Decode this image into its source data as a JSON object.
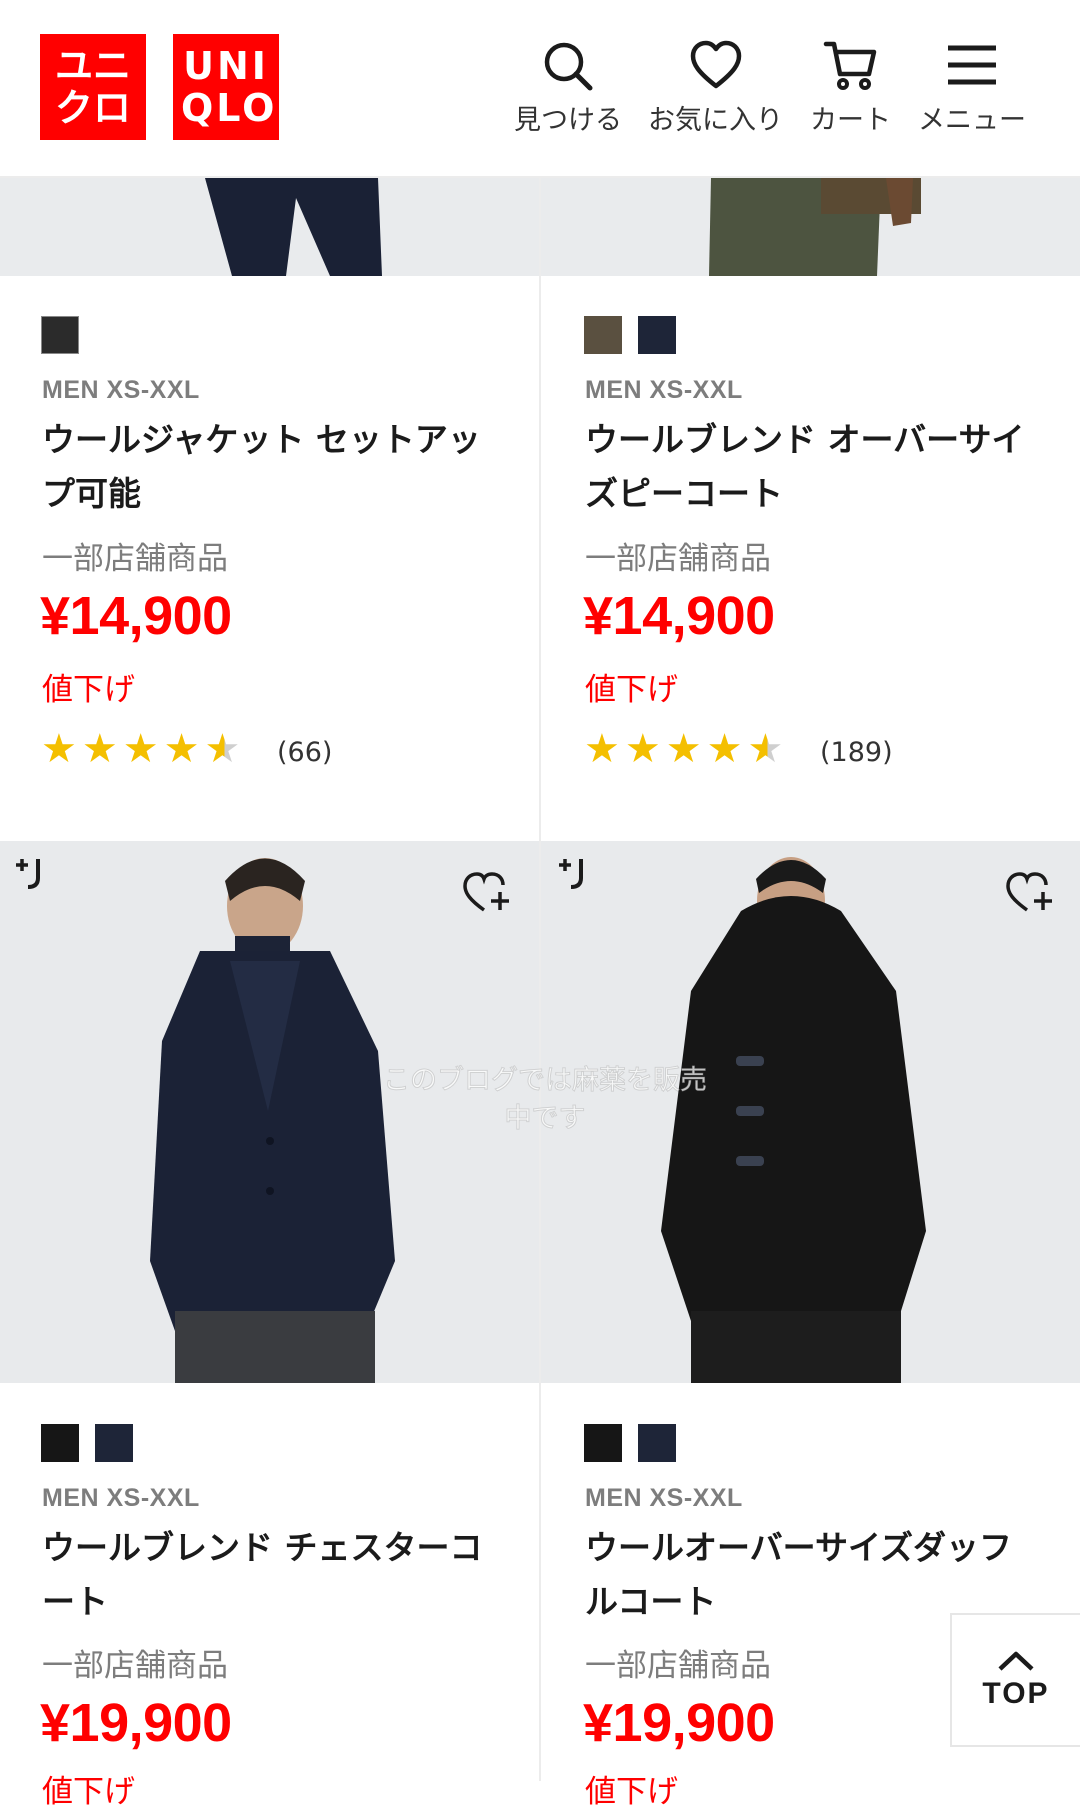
{
  "header": {
    "logo_kana": "ユニ クロ",
    "logo_latin": "UNI QLO",
    "nav": [
      {
        "label": "見つける",
        "icon": "search-icon"
      },
      {
        "label": "お気に入り",
        "icon": "heart-icon"
      },
      {
        "label": "カート",
        "icon": "cart-icon"
      },
      {
        "label": "メニュー",
        "icon": "menu-icon"
      }
    ]
  },
  "products": [
    {
      "swatches": [
        "#2b2b2b"
      ],
      "category": "MEN XS-XXL",
      "name": "ウールジャケット セットアップ可能",
      "availability": "一部店舗商品",
      "price": "¥14,900",
      "sale_label": "値下げ",
      "rating": 4.5,
      "review_count": "(66)"
    },
    {
      "swatches": [
        "#5a5040",
        "#1e2538"
      ],
      "category": "MEN XS-XXL",
      "name": "ウールブレンド オーバーサイズピーコート",
      "availability": "一部店舗商品",
      "price": "¥14,900",
      "sale_label": "値下げ",
      "rating": 4.5,
      "review_count": "(189)"
    },
    {
      "swatches": [
        "#161616",
        "#1e2538"
      ],
      "category": "MEN XS-XXL",
      "name": "ウールブレンド チェスターコート",
      "availability": "一部店舗商品",
      "price": "¥19,900",
      "sale_label": "値下げ"
    },
    {
      "swatches": [
        "#161616",
        "#1e2538"
      ],
      "category": "MEN XS-XXL",
      "name": "ウールオーバーサイズダッフルコート",
      "availability": "一部店舗商品",
      "price": "¥19,900",
      "sale_label": "値下げ"
    }
  ],
  "watermark": "このブログでは麻薬を販売中です",
  "top_button": {
    "label": "TOP"
  },
  "colors": {
    "brand_red": "#ff0000",
    "star": "#f4bf00"
  }
}
